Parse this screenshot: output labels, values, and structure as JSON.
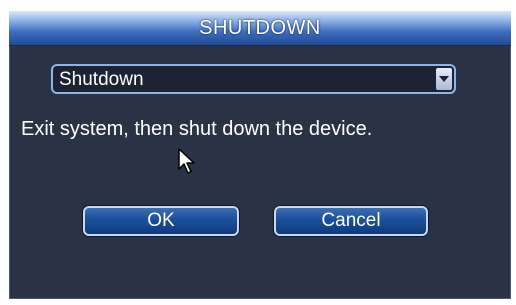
{
  "dialog": {
    "title": "SHUTDOWN",
    "mode_select": {
      "value": "Shutdown"
    },
    "description": "Exit system, then shut down the device.",
    "ok_label": "OK",
    "cancel_label": "Cancel"
  },
  "colors": {
    "background": "#2a3245",
    "title_bar": "#3f6fbf",
    "select_border": "#8ab7e8",
    "button": "#1d4f99",
    "text": "#ffffff"
  },
  "icons": {
    "dropdown": "chevron-down-icon",
    "pointer": "mouse-cursor-icon"
  }
}
